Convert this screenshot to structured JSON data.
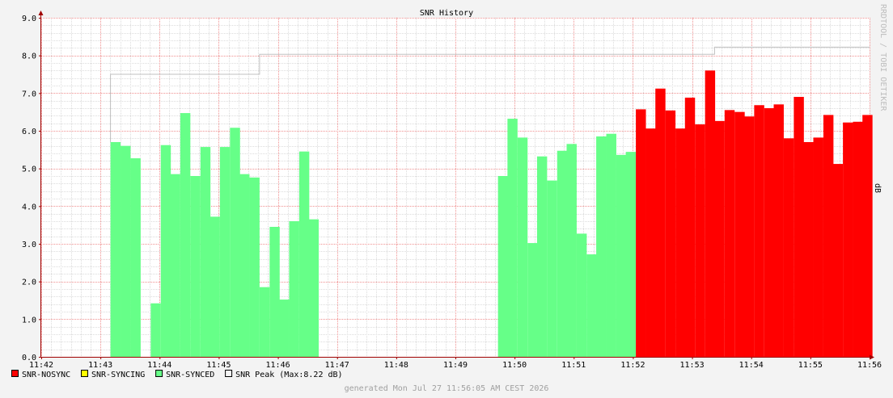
{
  "chart_data": {
    "type": "area",
    "title": "SNR History",
    "ylabel": "dB",
    "watermark": "RRDTOOL / TOBI OETIKER",
    "generated": "generated Mon Jul 27 11:56:05 AM CEST 2026",
    "ylim": [
      0,
      9
    ],
    "y_ticks": [
      "0.0",
      "1.0",
      "2.0",
      "3.0",
      "4.0",
      "5.0",
      "6.0",
      "7.0",
      "8.0",
      "9.0"
    ],
    "x_ticks": [
      "11:42",
      "11:43",
      "11:44",
      "11:45",
      "11:46",
      "11:47",
      "11:48",
      "11:49",
      "11:50",
      "11:51",
      "11:52",
      "11:53",
      "11:54",
      "11:55",
      "11:56"
    ],
    "x_range_minutes": [
      0,
      14
    ],
    "grid": true,
    "legend_position": "bottom-left",
    "colors": {
      "nosync": "#ff0000",
      "syncing": "#ffff00",
      "synced": "#66ff88",
      "peak": "#c0c0c0",
      "grid_major": "#f09090",
      "grid_minor": "#dcdcdc",
      "frame": "#a00000"
    },
    "series": [
      {
        "name": "SNR-SYNCED",
        "legend": "SNR-SYNCED",
        "color": "#66ff88",
        "bar_width_min": 0.166,
        "points": [
          [
            1.17,
            5.7
          ],
          [
            1.34,
            5.6
          ],
          [
            1.51,
            5.27
          ],
          [
            1.85,
            1.42
          ],
          [
            2.02,
            5.62
          ],
          [
            2.18,
            4.85
          ],
          [
            2.35,
            6.47
          ],
          [
            2.52,
            4.8
          ],
          [
            2.69,
            5.57
          ],
          [
            2.85,
            3.72
          ],
          [
            3.02,
            5.57
          ],
          [
            3.19,
            6.08
          ],
          [
            3.35,
            4.85
          ],
          [
            3.52,
            4.76
          ],
          [
            3.69,
            1.85
          ],
          [
            3.86,
            3.45
          ],
          [
            4.02,
            1.52
          ],
          [
            4.19,
            3.6
          ],
          [
            4.36,
            5.45
          ],
          [
            4.52,
            3.65
          ],
          [
            7.72,
            4.8
          ],
          [
            7.88,
            6.32
          ],
          [
            8.05,
            5.82
          ],
          [
            8.22,
            3.02
          ],
          [
            8.38,
            5.32
          ],
          [
            8.55,
            4.68
          ],
          [
            8.72,
            5.47
          ],
          [
            8.88,
            5.65
          ],
          [
            9.05,
            3.27
          ],
          [
            9.22,
            2.72
          ],
          [
            9.38,
            5.85
          ],
          [
            9.55,
            5.92
          ],
          [
            9.72,
            5.36
          ],
          [
            9.88,
            5.44
          ]
        ]
      },
      {
        "name": "SNR-NOSYNC",
        "legend": "SNR-NOSYNC",
        "color": "#ff0000",
        "bar_width_min": 0.166,
        "points": [
          [
            10.05,
            6.57
          ],
          [
            10.22,
            6.06
          ],
          [
            10.38,
            7.12
          ],
          [
            10.55,
            6.54
          ],
          [
            10.72,
            6.06
          ],
          [
            10.88,
            6.88
          ],
          [
            11.05,
            6.17
          ],
          [
            11.22,
            7.6
          ],
          [
            11.38,
            6.26
          ],
          [
            11.55,
            6.55
          ],
          [
            11.72,
            6.5
          ],
          [
            11.88,
            6.38
          ],
          [
            12.05,
            6.68
          ],
          [
            12.22,
            6.6
          ],
          [
            12.38,
            6.7
          ],
          [
            12.55,
            5.8
          ],
          [
            12.72,
            6.9
          ],
          [
            12.88,
            5.7
          ],
          [
            13.05,
            5.82
          ],
          [
            13.22,
            6.42
          ],
          [
            13.38,
            5.12
          ],
          [
            13.55,
            6.22
          ],
          [
            13.72,
            6.24
          ],
          [
            13.88,
            6.42
          ]
        ]
      },
      {
        "name": "SNR-SYNCING",
        "legend": "SNR-SYNCING",
        "color": "#ffff00",
        "points": []
      },
      {
        "name": "SNR Peak",
        "legend": "SNR Peak  (Max:8.22 dB)",
        "color": "#c0c0c0",
        "type": "step",
        "points": [
          [
            1.17,
            5.7
          ],
          [
            1.17,
            7.5
          ],
          [
            3.69,
            7.5
          ],
          [
            3.69,
            8.03
          ],
          [
            11.38,
            8.03
          ],
          [
            11.38,
            8.22
          ],
          [
            14.0,
            8.22
          ]
        ]
      }
    ],
    "legend": [
      {
        "label": "SNR-NOSYNC",
        "color": "#ff0000"
      },
      {
        "label": "SNR-SYNCING",
        "color": "#ffff00"
      },
      {
        "label": "SNR-SYNCED",
        "color": "#66ff88"
      },
      {
        "label": "SNR Peak  (Max:8.22 dB)",
        "color": "#f3f3f3"
      }
    ]
  }
}
